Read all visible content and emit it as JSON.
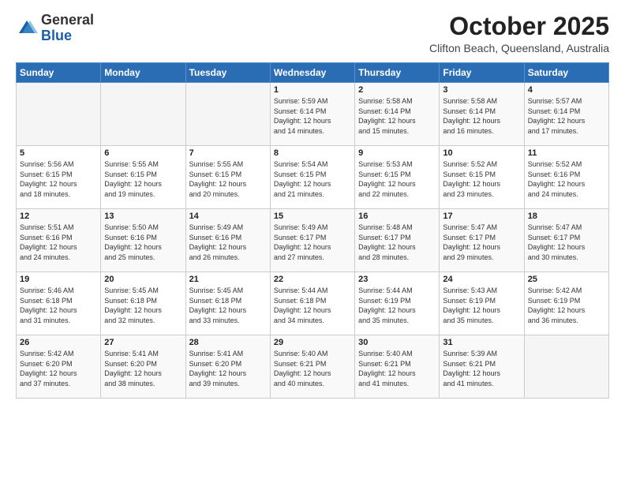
{
  "header": {
    "logo_line1": "General",
    "logo_line2": "Blue",
    "month_title": "October 2025",
    "location": "Clifton Beach, Queensland, Australia"
  },
  "weekdays": [
    "Sunday",
    "Monday",
    "Tuesday",
    "Wednesday",
    "Thursday",
    "Friday",
    "Saturday"
  ],
  "weeks": [
    [
      {
        "day": "",
        "info": ""
      },
      {
        "day": "",
        "info": ""
      },
      {
        "day": "",
        "info": ""
      },
      {
        "day": "1",
        "info": "Sunrise: 5:59 AM\nSunset: 6:14 PM\nDaylight: 12 hours\nand 14 minutes."
      },
      {
        "day": "2",
        "info": "Sunrise: 5:58 AM\nSunset: 6:14 PM\nDaylight: 12 hours\nand 15 minutes."
      },
      {
        "day": "3",
        "info": "Sunrise: 5:58 AM\nSunset: 6:14 PM\nDaylight: 12 hours\nand 16 minutes."
      },
      {
        "day": "4",
        "info": "Sunrise: 5:57 AM\nSunset: 6:14 PM\nDaylight: 12 hours\nand 17 minutes."
      }
    ],
    [
      {
        "day": "5",
        "info": "Sunrise: 5:56 AM\nSunset: 6:15 PM\nDaylight: 12 hours\nand 18 minutes."
      },
      {
        "day": "6",
        "info": "Sunrise: 5:55 AM\nSunset: 6:15 PM\nDaylight: 12 hours\nand 19 minutes."
      },
      {
        "day": "7",
        "info": "Sunrise: 5:55 AM\nSunset: 6:15 PM\nDaylight: 12 hours\nand 20 minutes."
      },
      {
        "day": "8",
        "info": "Sunrise: 5:54 AM\nSunset: 6:15 PM\nDaylight: 12 hours\nand 21 minutes."
      },
      {
        "day": "9",
        "info": "Sunrise: 5:53 AM\nSunset: 6:15 PM\nDaylight: 12 hours\nand 22 minutes."
      },
      {
        "day": "10",
        "info": "Sunrise: 5:52 AM\nSunset: 6:15 PM\nDaylight: 12 hours\nand 23 minutes."
      },
      {
        "day": "11",
        "info": "Sunrise: 5:52 AM\nSunset: 6:16 PM\nDaylight: 12 hours\nand 24 minutes."
      }
    ],
    [
      {
        "day": "12",
        "info": "Sunrise: 5:51 AM\nSunset: 6:16 PM\nDaylight: 12 hours\nand 24 minutes."
      },
      {
        "day": "13",
        "info": "Sunrise: 5:50 AM\nSunset: 6:16 PM\nDaylight: 12 hours\nand 25 minutes."
      },
      {
        "day": "14",
        "info": "Sunrise: 5:49 AM\nSunset: 6:16 PM\nDaylight: 12 hours\nand 26 minutes."
      },
      {
        "day": "15",
        "info": "Sunrise: 5:49 AM\nSunset: 6:17 PM\nDaylight: 12 hours\nand 27 minutes."
      },
      {
        "day": "16",
        "info": "Sunrise: 5:48 AM\nSunset: 6:17 PM\nDaylight: 12 hours\nand 28 minutes."
      },
      {
        "day": "17",
        "info": "Sunrise: 5:47 AM\nSunset: 6:17 PM\nDaylight: 12 hours\nand 29 minutes."
      },
      {
        "day": "18",
        "info": "Sunrise: 5:47 AM\nSunset: 6:17 PM\nDaylight: 12 hours\nand 30 minutes."
      }
    ],
    [
      {
        "day": "19",
        "info": "Sunrise: 5:46 AM\nSunset: 6:18 PM\nDaylight: 12 hours\nand 31 minutes."
      },
      {
        "day": "20",
        "info": "Sunrise: 5:45 AM\nSunset: 6:18 PM\nDaylight: 12 hours\nand 32 minutes."
      },
      {
        "day": "21",
        "info": "Sunrise: 5:45 AM\nSunset: 6:18 PM\nDaylight: 12 hours\nand 33 minutes."
      },
      {
        "day": "22",
        "info": "Sunrise: 5:44 AM\nSunset: 6:18 PM\nDaylight: 12 hours\nand 34 minutes."
      },
      {
        "day": "23",
        "info": "Sunrise: 5:44 AM\nSunset: 6:19 PM\nDaylight: 12 hours\nand 35 minutes."
      },
      {
        "day": "24",
        "info": "Sunrise: 5:43 AM\nSunset: 6:19 PM\nDaylight: 12 hours\nand 35 minutes."
      },
      {
        "day": "25",
        "info": "Sunrise: 5:42 AM\nSunset: 6:19 PM\nDaylight: 12 hours\nand 36 minutes."
      }
    ],
    [
      {
        "day": "26",
        "info": "Sunrise: 5:42 AM\nSunset: 6:20 PM\nDaylight: 12 hours\nand 37 minutes."
      },
      {
        "day": "27",
        "info": "Sunrise: 5:41 AM\nSunset: 6:20 PM\nDaylight: 12 hours\nand 38 minutes."
      },
      {
        "day": "28",
        "info": "Sunrise: 5:41 AM\nSunset: 6:20 PM\nDaylight: 12 hours\nand 39 minutes."
      },
      {
        "day": "29",
        "info": "Sunrise: 5:40 AM\nSunset: 6:21 PM\nDaylight: 12 hours\nand 40 minutes."
      },
      {
        "day": "30",
        "info": "Sunrise: 5:40 AM\nSunset: 6:21 PM\nDaylight: 12 hours\nand 41 minutes."
      },
      {
        "day": "31",
        "info": "Sunrise: 5:39 AM\nSunset: 6:21 PM\nDaylight: 12 hours\nand 41 minutes."
      },
      {
        "day": "",
        "info": ""
      }
    ]
  ]
}
